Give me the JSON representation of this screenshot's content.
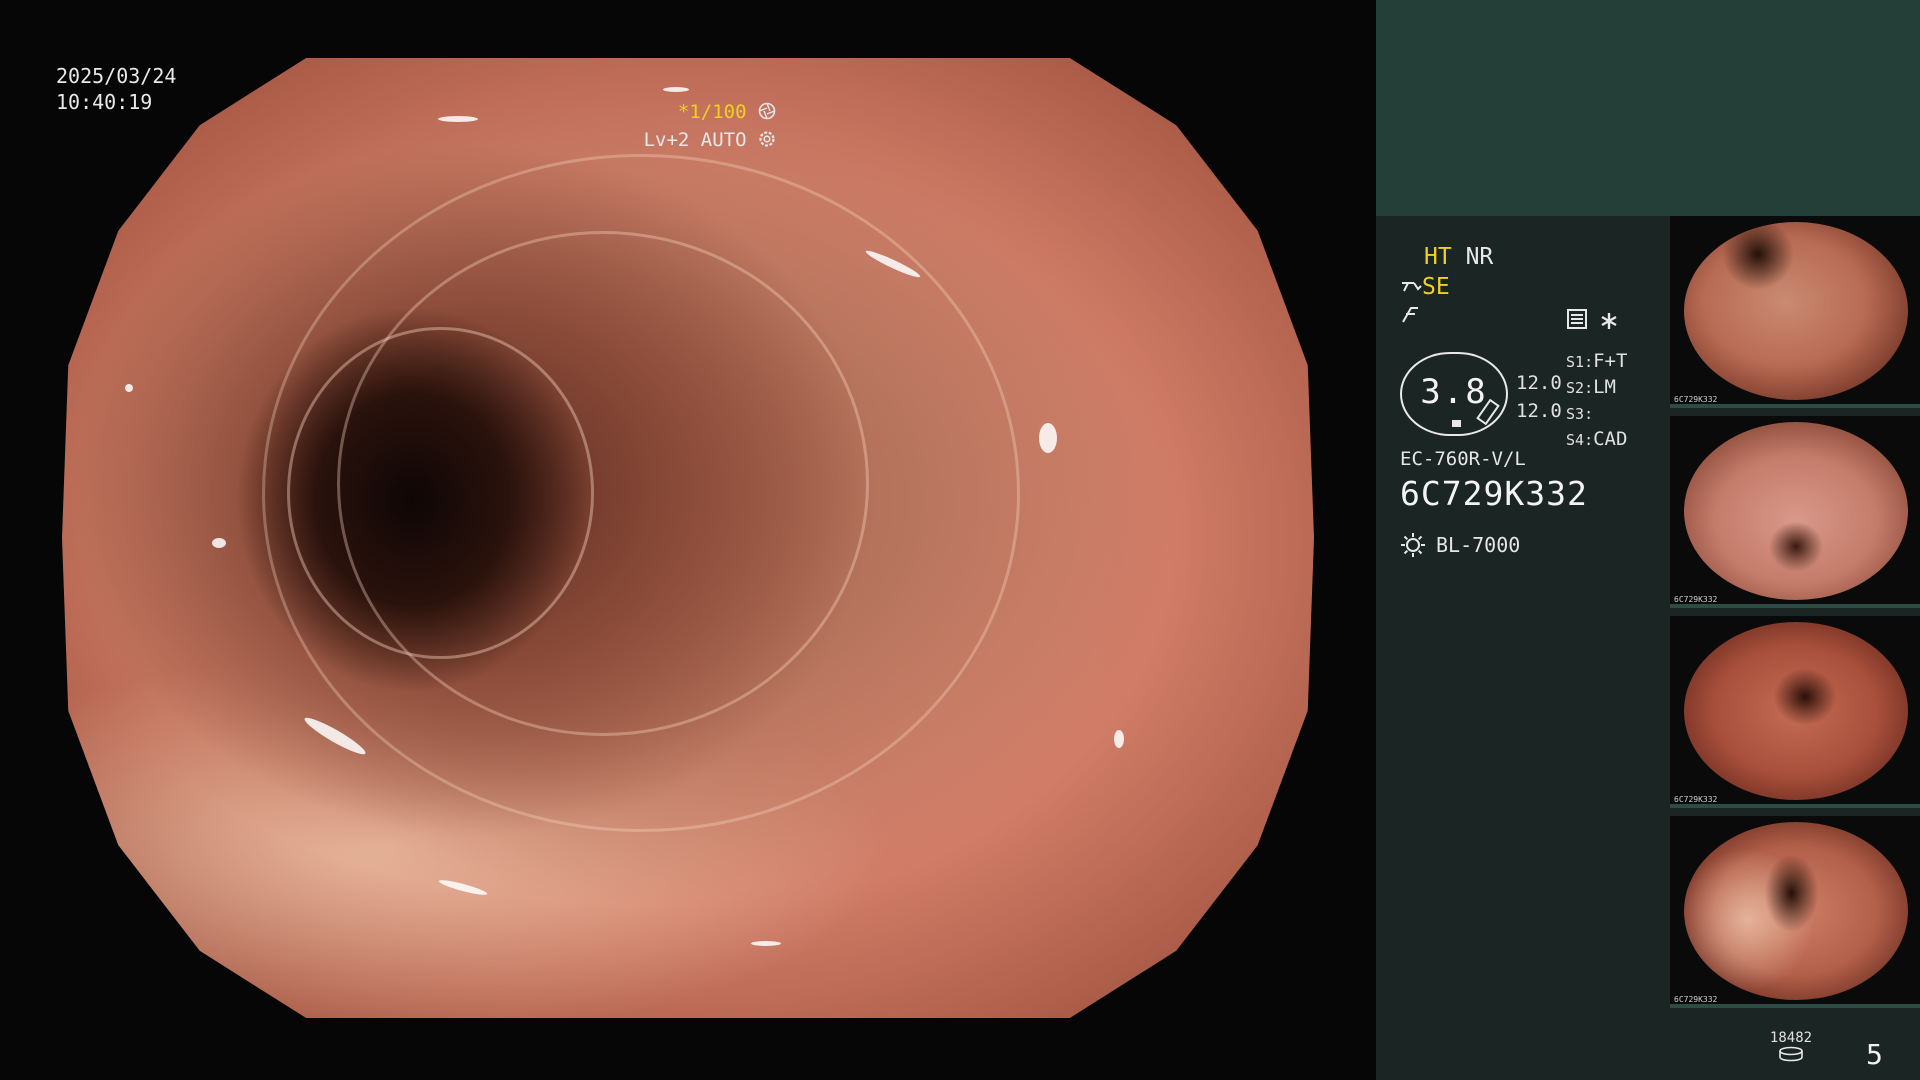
{
  "osd": {
    "date": "2025/03/24",
    "time": "10:40:19",
    "shutter": "*1/100",
    "level": "Lv+2",
    "auto": "AUTO"
  },
  "modes": {
    "ht": "HT",
    "nr": "NR",
    "se": "SE"
  },
  "badge": {
    "value": "3.8"
  },
  "settings": {
    "value_1": "12.0",
    "value_2": "12.0",
    "switches": [
      {
        "key": "S1",
        "value": "F+T"
      },
      {
        "key": "S2",
        "value": "LM"
      },
      {
        "key": "S3",
        "value": ""
      },
      {
        "key": "S4",
        "value": "CAD"
      }
    ]
  },
  "scope": {
    "model": "EC-760R-V/L",
    "serial": "6C729K332",
    "light_source": "BL-7000"
  },
  "thumbnails": [
    {
      "label": "6C729K332"
    },
    {
      "label": "6C729K332"
    },
    {
      "label": "6C729K332"
    },
    {
      "label": "6C729K332"
    }
  ],
  "footer": {
    "counter": "18482",
    "page": "5"
  },
  "colors": {
    "accent_yellow": "#f0d020",
    "panel_header": "#243e38",
    "panel_body": "#1b2523"
  },
  "icons": [
    "aperture-icon",
    "gear-icon",
    "hand-mode-icon",
    "pen-mode-icon",
    "menu-icon",
    "asterisk-icon",
    "sun-icon",
    "storage-icon"
  ]
}
